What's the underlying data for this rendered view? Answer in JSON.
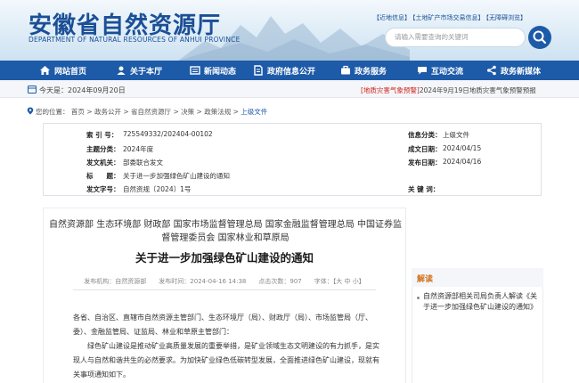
{
  "header": {
    "logo_cn": "安徽省自然资源厅",
    "logo_en": "DEPARTMENT OF NATURAL RESOURCES OF ANHUI PROVINCE",
    "links": [
      "【近地信息】",
      "【土地矿产市场交易信息】",
      "【无障碍浏览】"
    ],
    "search_placeholder": "请输入需要查询的关键词"
  },
  "nav": [
    "网站首页",
    "关于本厅",
    "新闻动态",
    "政府信息公开",
    "政务服务",
    "互动交流",
    "政务新媒体"
  ],
  "date_bar": {
    "today": "今天是：2024年09月20日",
    "warning_tag": "[地质灾害气象预警]",
    "warning_text": "2024年9月19日地质灾害气象预警预报"
  },
  "breadcrumb": {
    "items": [
      "您的位置：",
      "首页",
      "政务公开",
      "省自然资源厅",
      "决策",
      "政策法规"
    ],
    "current": "上级文件",
    "sep": ">"
  },
  "meta": {
    "left": [
      {
        "label": "索 引 号：",
        "value": "725549332/202404-00102"
      },
      {
        "label": "主题分类：",
        "value": "2024年度"
      },
      {
        "label": "发文机关：",
        "value": "部委联合发文"
      },
      {
        "label": "标　　题：",
        "value": "关于进一步加强绿色矿山建设的通知"
      },
      {
        "label": "发文字号：",
        "value": "自然资规〔2024〕1号"
      }
    ],
    "right": [
      {
        "label": "信息分类：",
        "value": "上级文件"
      },
      {
        "label": "成文日期：",
        "value": "2024/04/15"
      },
      {
        "label": "发布日期：",
        "value": "2024/04/16"
      },
      {
        "label": "关 键 词：",
        "value": ""
      }
    ]
  },
  "doc": {
    "issuers": "自然资源部 生态环境部 财政部 国家市场监督管理总局 国家金融监督管理总局 中国证券监督管理委员会 国家林业和草原局",
    "title": "关于进一步加强绿色矿山建设的通知",
    "pub_info": "发布机构：自然资源部　　发布时间：2024-04-16 14:38　　点击次数：907　　字体：【大 中 小】",
    "paragraphs": [
      "各省、自治区、直辖市自然资源主管部门、生态环境厅（局）、财政厅（局）、市场监管局（厅、委）、金融监管局、证监局、林业和草原主管部门：",
      "绿色矿山建设是推动矿业高质量发展的重要举措，是矿业领域生态文明建设的有力抓手，是实现人与自然和谐共生的必然要求。为加快矿业绿色低碳转型发展，全面推进绿色矿山建设，现就有关事项通知如下。"
    ]
  },
  "sidebar": {
    "heading": "解读",
    "link": "自然资源部相关司局负责人解读《关于进一步加强绿色矿山建设的通知》"
  },
  "colors": {
    "brand": "#1d5aa8",
    "warning": "#d0201b",
    "accent": "#d0701b"
  }
}
